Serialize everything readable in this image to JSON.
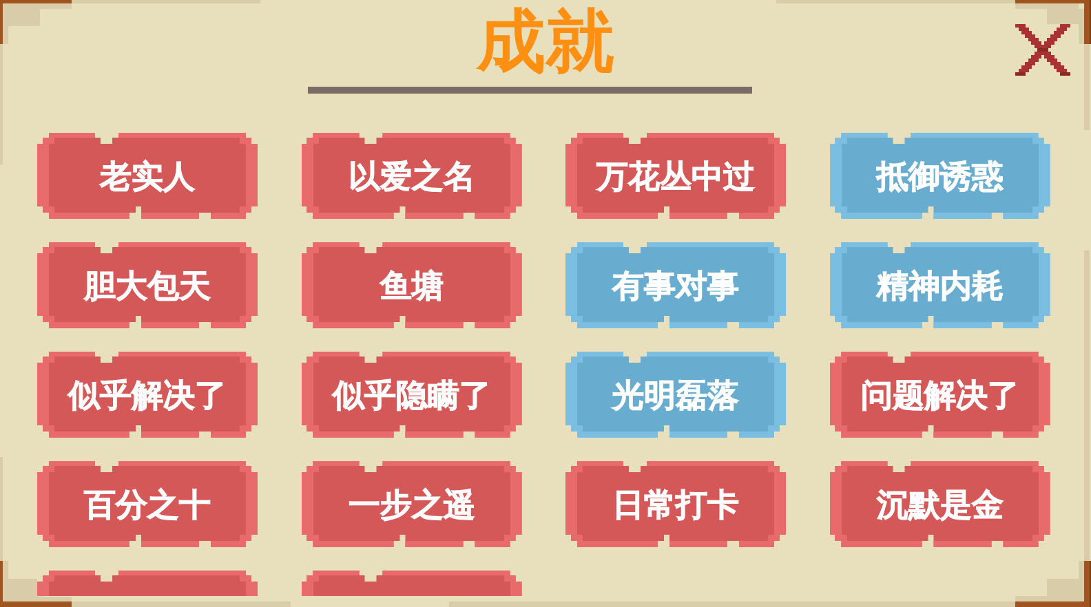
{
  "title": "成就",
  "achievements": [
    {
      "label": "老实人",
      "color": "#d45858"
    },
    {
      "label": "以爱之名",
      "color": "#d45858"
    },
    {
      "label": "万花丛中过",
      "color": "#d45858"
    },
    {
      "label": "抵御诱惑",
      "color": "#68acd0"
    },
    {
      "label": "胆大包天",
      "color": "#d45858"
    },
    {
      "label": "鱼塘",
      "color": "#d45858"
    },
    {
      "label": "有事对事",
      "color": "#68acd0"
    },
    {
      "label": "精神内耗",
      "color": "#68acd0"
    },
    {
      "label": "似乎解决了",
      "color": "#d45858"
    },
    {
      "label": "似乎隐瞒了",
      "color": "#d45858"
    },
    {
      "label": "光明磊落",
      "color": "#68acd0"
    },
    {
      "label": "问题解决了",
      "color": "#d45858"
    },
    {
      "label": "百分之十",
      "color": "#d45858"
    },
    {
      "label": "一步之遥",
      "color": "#d45858"
    },
    {
      "label": "日常打卡",
      "color": "#d45858"
    },
    {
      "label": "沉默是金",
      "color": "#d45858"
    }
  ],
  "partially_visible_achievements": [
    {
      "color": "#d45858"
    },
    {
      "color": "#d45858"
    }
  ]
}
